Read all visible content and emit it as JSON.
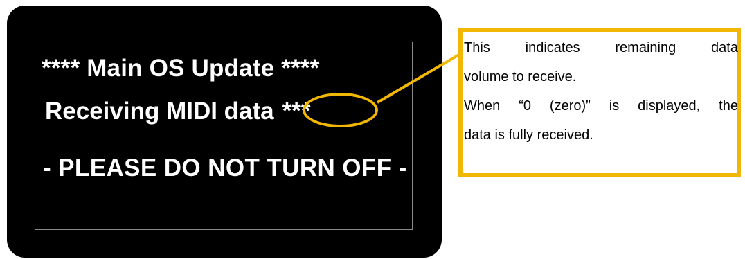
{
  "display": {
    "line1": "**** Main OS Update ****",
    "line2_label": "Receiving MIDI data",
    "line2_counter": "***",
    "line3": "- PLEASE DO NOT TURN OFF -"
  },
  "callout": {
    "para1_line1_words": [
      "This",
      "indicates",
      "remaining",
      "data"
    ],
    "para1_line2": "volume to receive.",
    "para2_line1_words": [
      "When",
      "“0",
      "(zero)”",
      "is",
      "displayed,",
      "the"
    ],
    "para2_line2": "data is fully received."
  },
  "colors": {
    "screen": "#000000",
    "text": "#ffffff",
    "accent": "#f2b705"
  }
}
